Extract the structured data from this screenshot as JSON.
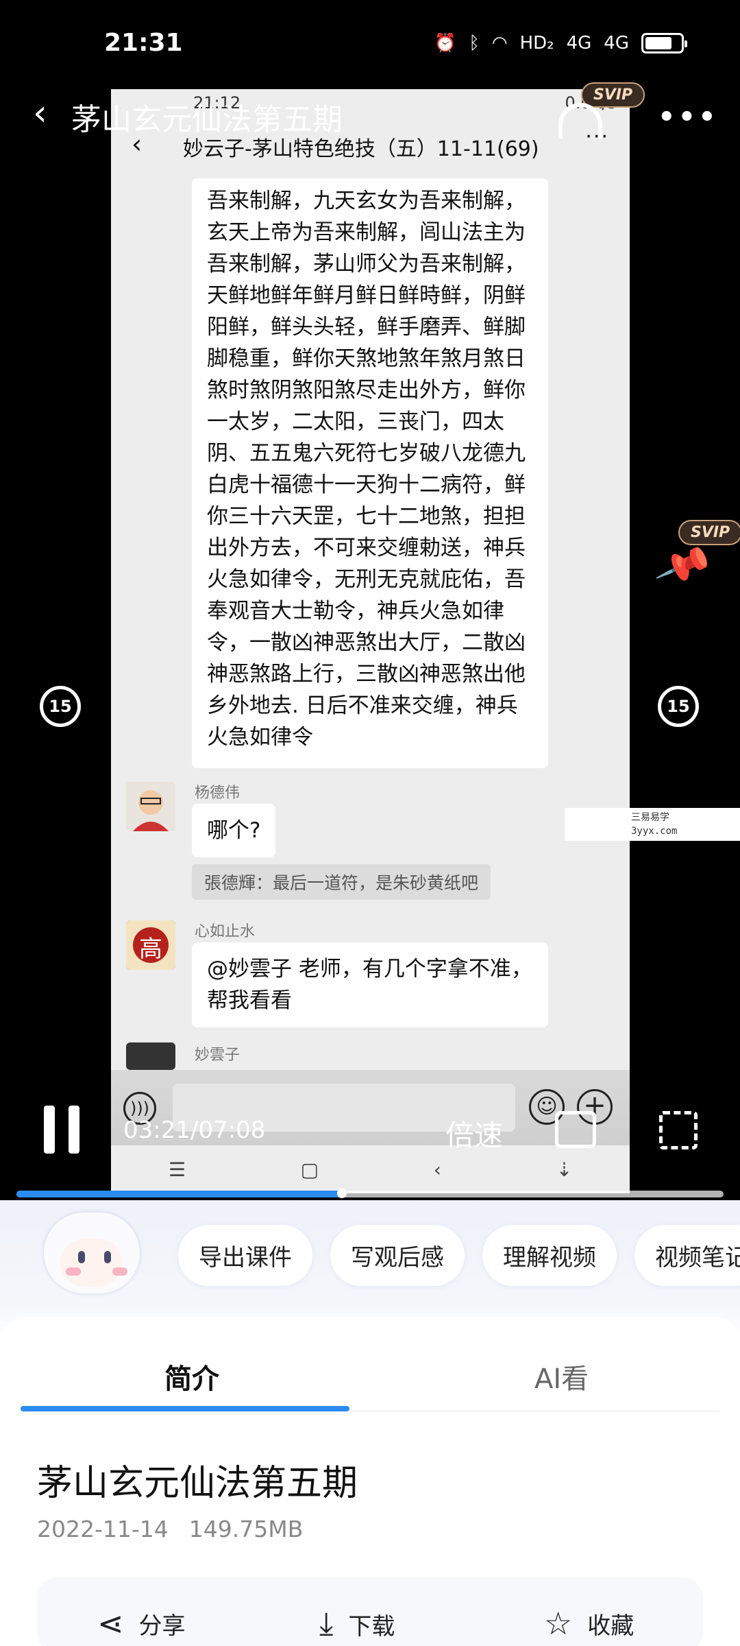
{
  "status": {
    "time": "21:31",
    "icons": [
      "alarm-icon",
      "bluetooth-icon",
      "wifi-icon",
      "hd-icon",
      "signal-4g-icon",
      "signal-4g-icon",
      "battery-icon"
    ],
    "hd_label": "HD₂",
    "net1": "4G",
    "net2": "4G"
  },
  "player": {
    "title": "茅山玄元仙法第五期",
    "svip_badge": "SVIP",
    "time_display": "03:21/07:08",
    "progress": 0.46,
    "speed_label": "倍速",
    "skip_back": "15",
    "skip_forward": "15"
  },
  "inner_screen": {
    "status_time": "21:12",
    "status_right": "0.0K/s",
    "chat_title": "妙云子-茅山特色绝技（五）11-11(69)",
    "long_message": "吾来制解，九天玄女为吾来制解，玄天上帝为吾来制解，闾山法主为吾来制解，茅山师父为吾来制解，天鲜地鲜年鲜月鲜日鲜時鲜，阴鲜阳鲜，鲜头头轻，鲜手磨弄、鲜脚脚稳重，鲜你天煞地煞年煞月煞日煞时煞阴煞阳煞尽走出外方，鲜你一太岁，二太阳，三丧门，四太阴、五五鬼六死符七岁破八龙德九白虎十福德十一天狗十二病符，鲜你三十六天罡，七十二地煞，担担出外方去，不可来交缠勅送，神兵火急如律令，无刑无克就庇佑，吾奉观音大士勒令，神兵火急如律令，一散凶神恶煞出大厅，二散凶神恶煞路上行，三散凶神恶煞出他乡外地去. 日后不准来交缠，神兵火急如律令",
    "sender1": "杨德伟",
    "msg1": "哪个?",
    "system_msg": "張德輝：最后一道符，是朱砂黄纸吧",
    "sender2": "心如止水",
    "avatar2_char": "高",
    "msg2": "@妙雲子  老师，有几个字拿不准，帮我看看",
    "sender3": "妙雲子"
  },
  "watermark": {
    "line1": "三易易学",
    "line2": "3yyx.com"
  },
  "ai_chips": [
    "导出课件",
    "写观后感",
    "理解视频",
    "视频笔记"
  ],
  "tabs": {
    "intro": "简介",
    "ai": "AI看"
  },
  "video": {
    "title": "茅山玄元仙法第五期",
    "date": "2022-11-14",
    "size": "149.75MB"
  },
  "actions": {
    "share": "分享",
    "download": "下载",
    "favorite": "收藏"
  },
  "colors": {
    "accent": "#2a8cf0",
    "svip_bg": "#3a2b22",
    "svip_text": "#f5dbbd"
  }
}
